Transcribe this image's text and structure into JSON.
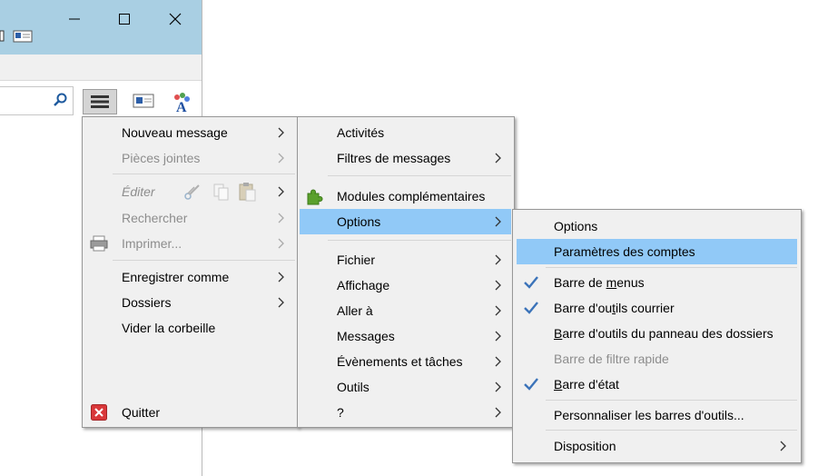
{
  "window": {
    "minimize_icon": "minimize-icon",
    "maximize_icon": "maximize-icon",
    "close_icon": "close-icon"
  },
  "main_menu": {
    "items": [
      {
        "label": "Nouveau message",
        "disabled": false,
        "submenu": true
      },
      {
        "label": "Pièces jointes",
        "disabled": true,
        "submenu": true
      },
      {
        "label": "Éditer",
        "disabled": true,
        "submenu": true
      },
      {
        "label": "Rechercher",
        "disabled": true,
        "submenu": true
      },
      {
        "label": "Imprimer...",
        "disabled": true,
        "submenu": true
      },
      {
        "label": "Enregistrer comme",
        "disabled": false,
        "submenu": true
      },
      {
        "label": "Dossiers",
        "disabled": false,
        "submenu": true
      },
      {
        "label": "Vider la corbeille",
        "disabled": false,
        "submenu": false
      },
      {
        "label": "Quitter",
        "disabled": false,
        "submenu": false
      }
    ]
  },
  "tools_menu": {
    "items": [
      {
        "label": "Activités",
        "submenu": false
      },
      {
        "label": "Filtres de messages",
        "submenu": true
      },
      {
        "label": "Modules complémentaires",
        "submenu": false
      },
      {
        "label": "Options",
        "submenu": true,
        "highlighted": true
      },
      {
        "label": "Fichier",
        "submenu": true
      },
      {
        "label": "Affichage",
        "submenu": true
      },
      {
        "label": "Aller à",
        "submenu": true
      },
      {
        "label": "Messages",
        "submenu": true
      },
      {
        "label": "Évènements et tâches",
        "submenu": true
      },
      {
        "label": "Outils",
        "submenu": true
      },
      {
        "label": "?",
        "submenu": true
      }
    ]
  },
  "options_menu": {
    "items": [
      {
        "label": "Options",
        "checked": false
      },
      {
        "label": "Paramètres des comptes",
        "checked": false,
        "highlighted": true
      },
      {
        "label_before": "Barre de ",
        "label_ul": "m",
        "label_after": "enus",
        "checked": true
      },
      {
        "label_before": "Barre d'ou",
        "label_ul": "t",
        "label_after": "ils courrier",
        "checked": true
      },
      {
        "label_before": "",
        "label_ul": "B",
        "label_after": "arre d'outils du panneau des dossiers",
        "checked": false
      },
      {
        "label": "Barre de filtre rapide",
        "checked": false,
        "disabled": true
      },
      {
        "label_before": "",
        "label_ul": "B",
        "label_after": "arre d'état",
        "checked": true
      },
      {
        "label": "Personnaliser les barres d'outils...",
        "checked": false
      },
      {
        "label": "Disposition",
        "checked": false,
        "submenu": true
      }
    ]
  },
  "colors": {
    "titlebar": "#a9cfe3",
    "menu_bg": "#f0f0f0",
    "highlight": "#91c9f7",
    "disabled_text": "#8d8d8d",
    "check": "#3b73b9"
  }
}
